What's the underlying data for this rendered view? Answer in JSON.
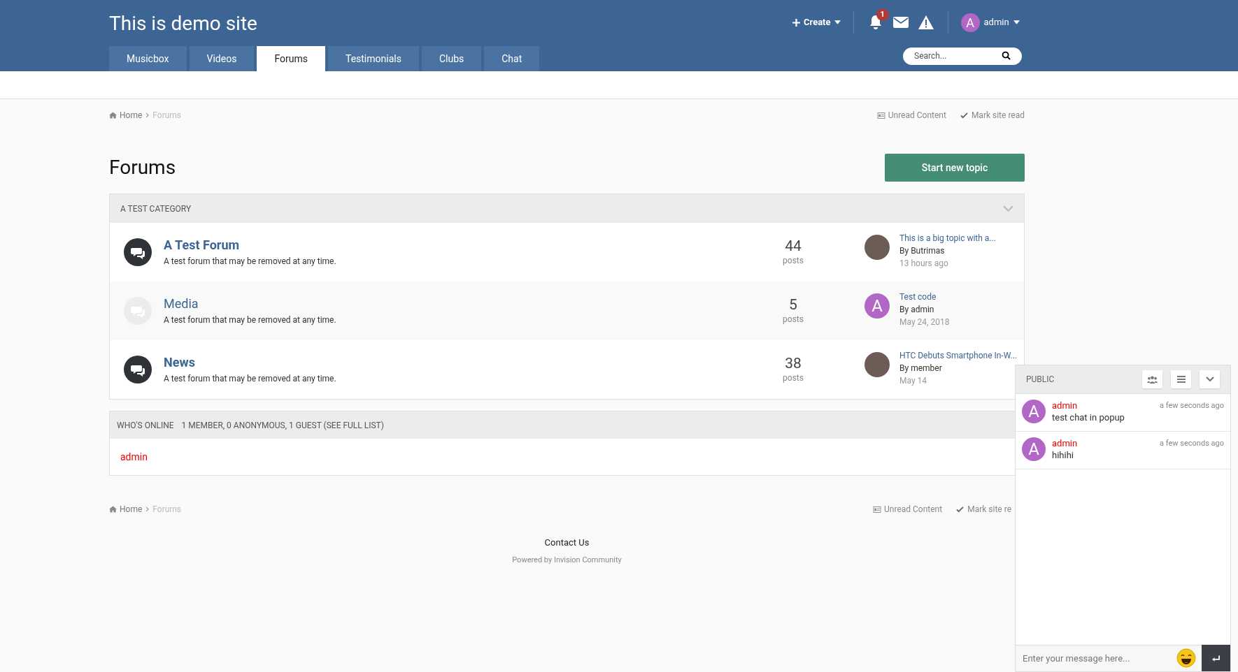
{
  "site_title": "This is demo site",
  "header_actions": {
    "create": "Create",
    "notifications_count": "1",
    "user": {
      "avatar": {
        "letter": "A",
        "color": "#b266c5"
      },
      "name": "admin"
    }
  },
  "nav_tabs": [
    {
      "label": "Musicbox",
      "selected": false
    },
    {
      "label": "Videos",
      "selected": false
    },
    {
      "label": "Forums",
      "selected": true
    },
    {
      "label": "Testimonials",
      "selected": false
    },
    {
      "label": "Clubs",
      "selected": false
    },
    {
      "label": "Chat",
      "selected": false
    }
  ],
  "search": {
    "placeholder": "Search..."
  },
  "breadcrumb": {
    "home": "Home",
    "current": "Forums"
  },
  "page_links": [
    "Unread Content",
    "Mark site read"
  ],
  "page_title": "Forums",
  "start_button": "Start new topic",
  "category": {
    "title": "A TEST CATEGORY",
    "expanded": true,
    "forums": [
      {
        "title": "A Test Forum",
        "description": "A test forum that may be removed at any time.",
        "unread": true,
        "count": "44",
        "count_label": "posts",
        "last_post": {
          "avatar": {
            "kind": "photo"
          },
          "title": "This is a big topic with a...",
          "by": "By Butrimas",
          "time": "13 hours ago"
        }
      },
      {
        "title": "Media",
        "description": "A test forum that may be removed at any time.",
        "unread": false,
        "count": "5",
        "count_label": "posts",
        "last_post": {
          "avatar": {
            "kind": "letter",
            "letter": "A",
            "color": "#b266c5"
          },
          "title": "Test code",
          "by": "By admin",
          "time": "May 24, 2018"
        }
      },
      {
        "title": "News",
        "description": "A test forum that may be removed at any time.",
        "unread": true,
        "count": "38",
        "count_label": "posts",
        "last_post": {
          "avatar": {
            "kind": "photo"
          },
          "title": "HTC Debuts Smartphone In-W...",
          "by": "By member",
          "time": "May 14"
        }
      }
    ]
  },
  "whos_online": {
    "title": "WHO'S ONLINE",
    "summary": "1 MEMBER, 0 ANONYMOUS, 1 GUEST (SEE FULL LIST)",
    "members": [
      "admin"
    ]
  },
  "footer_breadcrumb": {
    "home": "Home",
    "current": "Forums"
  },
  "footer_links": [
    "Unread Content",
    "Mark site re"
  ],
  "footer": {
    "contact": "Contact Us",
    "powered": "Powered by Invision Community"
  },
  "chat": {
    "title": "PUBLIC",
    "messages": [
      {
        "avatar": {
          "letter": "A",
          "color": "#b266c5"
        },
        "user": "admin",
        "time": "a few seconds ago",
        "text": "test chat in popup"
      },
      {
        "avatar": {
          "letter": "A",
          "color": "#b266c5"
        },
        "user": "admin",
        "time": "a few seconds ago",
        "text": "hihihi"
      }
    ],
    "input_placeholder": "Enter your message here..."
  }
}
